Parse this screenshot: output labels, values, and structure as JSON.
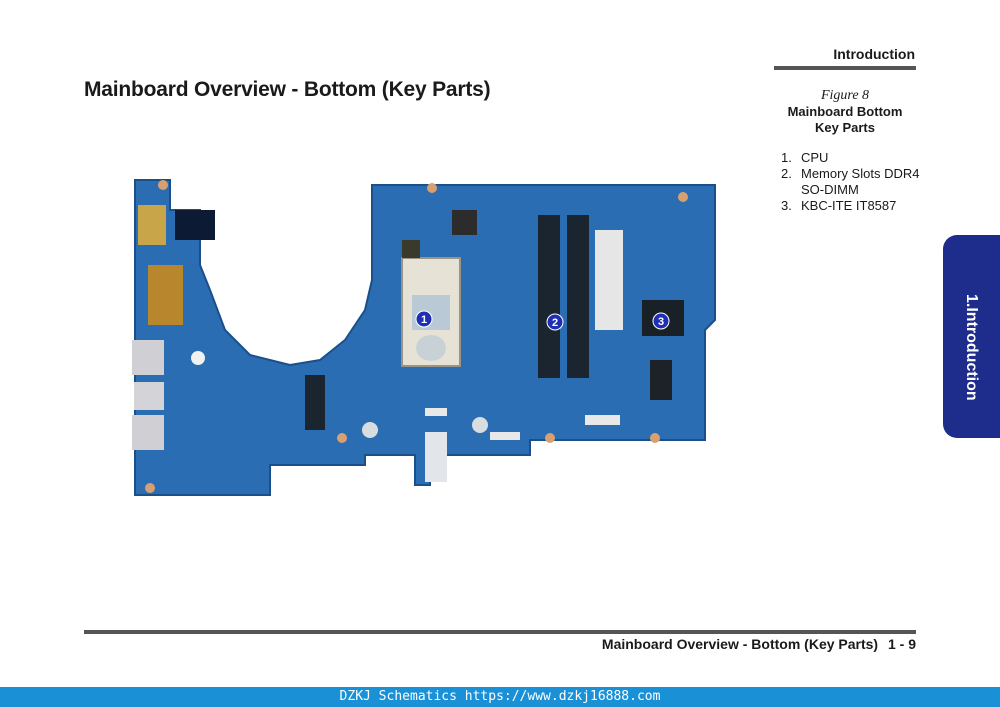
{
  "header": {
    "section": "Introduction",
    "title": "Mainboard Overview - Bottom (Key Parts)"
  },
  "figure": {
    "label": "Figure 8",
    "caption": "Mainboard Bottom Key Parts",
    "markers": [
      "1",
      "2",
      "3"
    ]
  },
  "parts": [
    {
      "num": "1.",
      "text": "CPU"
    },
    {
      "num": "2.",
      "text": "Memory Slots DDR4 SO-DIMM"
    },
    {
      "num": "3.",
      "text": "KBC-ITE IT8587"
    }
  ],
  "side_tab": {
    "label": "1.Introduction"
  },
  "footer": {
    "title": "Mainboard Overview - Bottom (Key Parts)",
    "page": "1 - 9"
  },
  "banner": {
    "text": "DZKJ Schematics https://www.dzkj16888.com"
  },
  "colors": {
    "pcb": "#2b6db3",
    "tab": "#1e2d8c",
    "banner": "#1a90d6",
    "marker": "#1e2fb5"
  }
}
